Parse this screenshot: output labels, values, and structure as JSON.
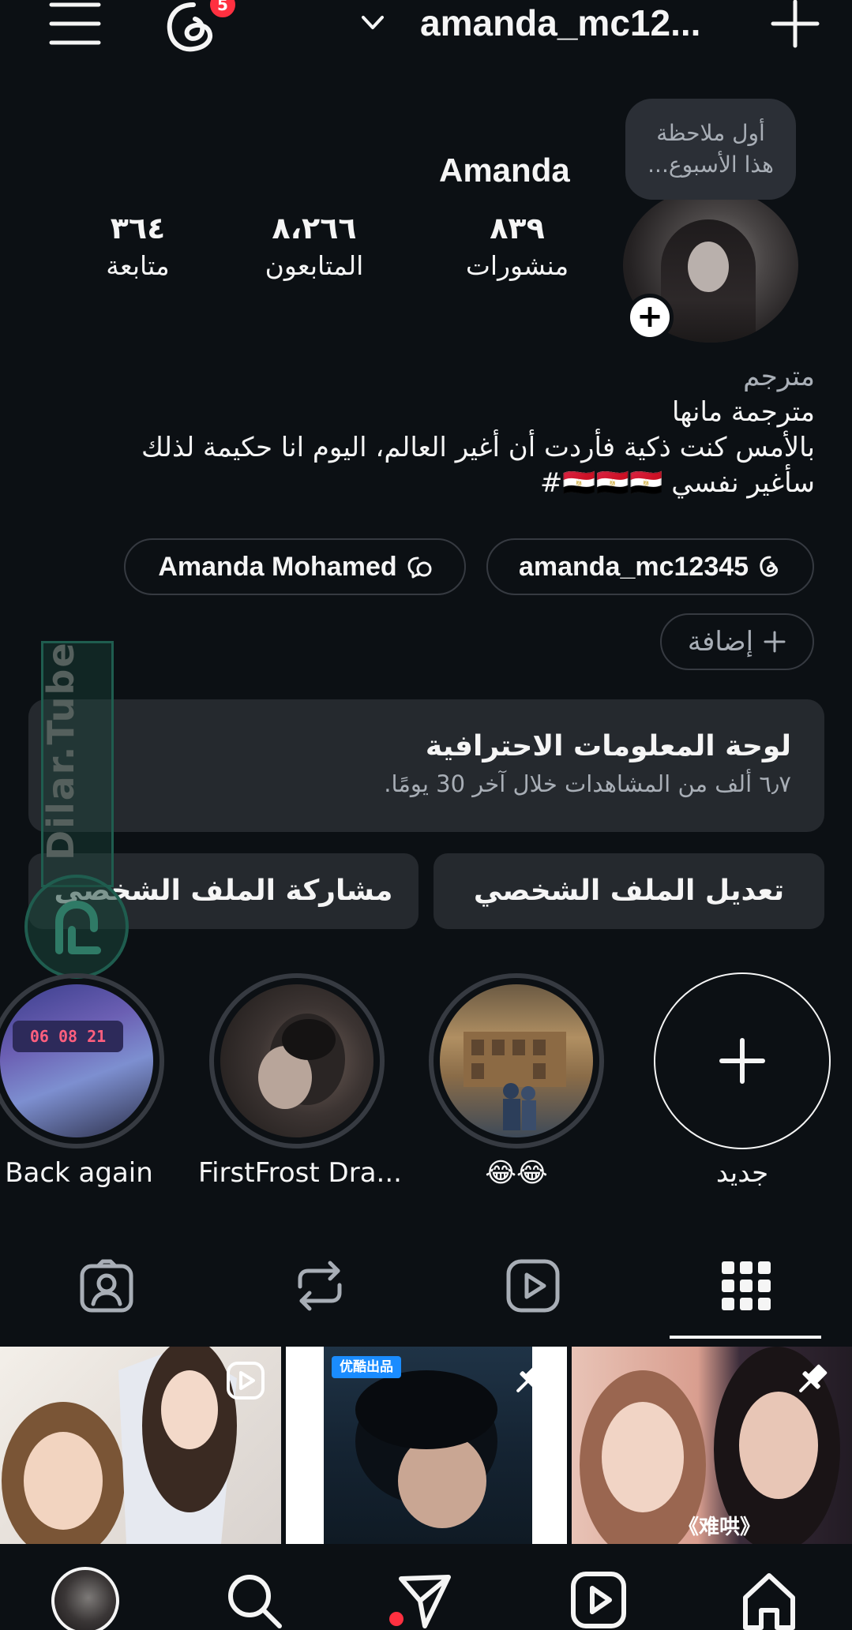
{
  "header": {
    "notification_count": "5",
    "username": "amanda_mc12..."
  },
  "profile": {
    "display_name": "Amanda",
    "note": [
      "أول ملاحظة",
      "هذا الأسبوع..."
    ],
    "stats": {
      "posts": {
        "value": "٨٣٩",
        "label": "منشورات"
      },
      "followers": {
        "value": "٨،٢٦٦",
        "label": "المتابعون"
      },
      "following": {
        "value": "٣٦٤",
        "label": "متابعة"
      }
    },
    "bio": {
      "category": "مترجم",
      "lines": [
        "مترجمة مانها",
        "بالأمس كنت ذكية فأردت أن أغير العالم، اليوم انا حكيمة لذلك",
        "سأغير نفسي 🇪🇬🇪🇬🇪🇬#"
      ]
    },
    "links": {
      "threads": "amanda_mc12345",
      "facebook": "Amanda Mohamed",
      "add": "إضافة"
    }
  },
  "dashboard": {
    "title": "لوحة المعلومات الاحترافية",
    "subtitle": "٦٫٧ ألف من المشاهدات خلال آخر 30 يومًا."
  },
  "buttons": {
    "edit_profile": "تعديل الملف الشخصي",
    "share_profile": "مشاركة الملف الشخصي"
  },
  "watermark": "Dilar.Tube",
  "highlights": [
    {
      "label": "جديد"
    },
    {
      "label": "😂😂"
    },
    {
      "label": "FirstFrost Dra..."
    },
    {
      "label": "Back again",
      "timer": "06 08 21"
    }
  ],
  "grid_badges": {
    "cell2_tag": "优酷出品",
    "cell3_caption": "《难哄》"
  },
  "colors": {
    "background": "#0c1014",
    "surface": "#25292e",
    "badge": "#ff3040",
    "muted_text": "#a8aeb6"
  }
}
